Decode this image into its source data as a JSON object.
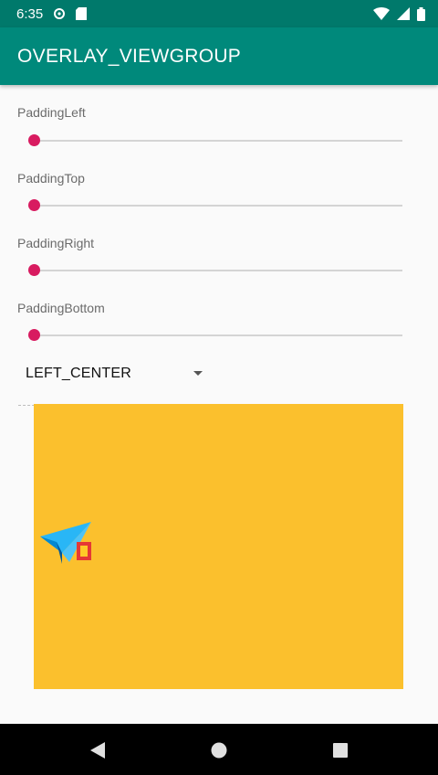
{
  "status_bar": {
    "time": "6:35",
    "icons": [
      "notification-icon",
      "sd-card-icon",
      "wifi-icon",
      "signal-icon",
      "battery-icon"
    ],
    "color": "#00796b"
  },
  "app_bar": {
    "title": "OVERLAY_VIEWGROUP",
    "color": "#00897b"
  },
  "seekbars": [
    {
      "label": "PaddingLeft",
      "progress": 0
    },
    {
      "label": "PaddingTop",
      "progress": 0
    },
    {
      "label": "PaddingRight",
      "progress": 0
    },
    {
      "label": "PaddingBottom",
      "progress": 0
    }
  ],
  "spinner": {
    "selected": "LEFT_CENTER"
  },
  "overlay": {
    "background": "#fbc02d",
    "icon": "paper-plane-icon",
    "gravity": "LEFT_CENTER"
  },
  "colors": {
    "accent": "#d81b60",
    "track": "#d4d4d4"
  },
  "nav_bar": {
    "buttons": [
      "back-icon",
      "home-icon",
      "recents-icon"
    ]
  }
}
